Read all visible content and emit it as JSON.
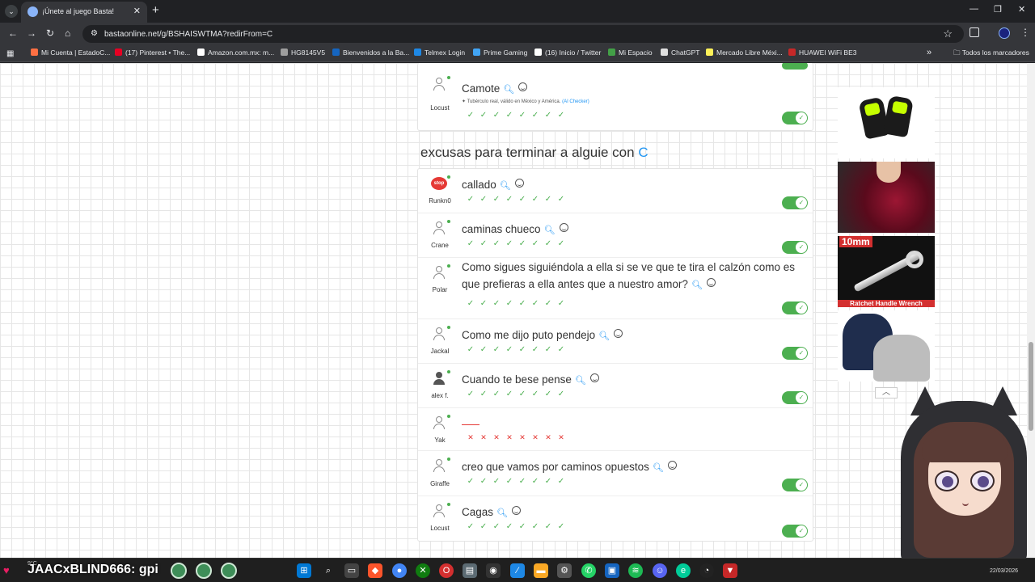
{
  "browser": {
    "tab_title": "¡Únete al juego Basta!",
    "url": "bastaonline.net/g/BSHAISWTMA?redirFrom=C",
    "bookmarks": [
      {
        "label": "Mi Cuenta | EstadoC...",
        "color": "#ff7043"
      },
      {
        "label": "(17) Pinterest • The...",
        "color": "#e60023"
      },
      {
        "label": "Amazon.com.mx: m...",
        "color": "#ffffff"
      },
      {
        "label": "HG8145V5",
        "color": "#9e9e9e"
      },
      {
        "label": "Bienvenidos a la Ba...",
        "color": "#1565c0"
      },
      {
        "label": "Telmex Login",
        "color": "#1e88e5"
      },
      {
        "label": "Prime Gaming",
        "color": "#42a5f5"
      },
      {
        "label": "(16) Inicio / Twitter",
        "color": "#ffffff"
      },
      {
        "label": "Mi Espacio",
        "color": "#43a047"
      },
      {
        "label": "ChatGPT",
        "color": "#e0e0e0"
      },
      {
        "label": "Mercado Libre Méxi...",
        "color": "#fff159"
      },
      {
        "label": "HUAWEI WiFi BE3",
        "color": "#c62828"
      }
    ],
    "bookmarks_folder": "Todos los marcadores"
  },
  "game": {
    "previous_answer": {
      "player": "Locust",
      "text": "Camote",
      "note": "Tubérculo real, válido en México y América.",
      "note_link": "(AI Checker)",
      "votes": [
        "yes",
        "yes",
        "yes",
        "yes",
        "yes",
        "yes",
        "yes",
        "yes"
      ],
      "valid": true
    },
    "category_title": "excusas para terminar a alguie con",
    "letter": "C",
    "answers": [
      {
        "player": "Runkn0",
        "text": "callado",
        "avatar": "stop",
        "votes": [
          "yes",
          "yes",
          "yes",
          "yes",
          "yes",
          "yes",
          "yes",
          "yes"
        ],
        "valid": true
      },
      {
        "player": "Crane",
        "text": "caminas chueco",
        "avatar": "default",
        "votes": [
          "yes",
          "yes",
          "yes",
          "yes",
          "yes",
          "yes",
          "yes",
          "yes"
        ],
        "valid": true
      },
      {
        "player": "Polar",
        "text": "Como sigues siguiéndola a ella si se ve que te tira el calzón como es que prefieras a ella antes que a nuestro amor?",
        "avatar": "default",
        "votes": [
          "yes",
          "yes",
          "yes",
          "yes",
          "yes",
          "yes",
          "yes",
          "yes"
        ],
        "valid": true
      },
      {
        "player": "Jackal",
        "text": "Como me dijo puto pendejo",
        "avatar": "default",
        "votes": [
          "yes",
          "yes",
          "yes",
          "yes",
          "yes",
          "yes",
          "yes",
          "yes"
        ],
        "valid": true
      },
      {
        "player": "alex f.",
        "text": "Cuando te bese pense",
        "avatar": "dark",
        "votes": [
          "yes",
          "yes",
          "yes",
          "yes",
          "yes",
          "yes",
          "yes",
          "yes"
        ],
        "valid": true
      },
      {
        "player": "Yak",
        "text": "",
        "avatar": "default",
        "votes": [
          "no",
          "no",
          "no",
          "no",
          "no",
          "no",
          "no",
          "no"
        ],
        "valid": false
      },
      {
        "player": "Giraffe",
        "text": "creo que vamos por caminos opuestos",
        "avatar": "default",
        "votes": [
          "yes",
          "yes",
          "yes",
          "yes",
          "yes",
          "yes",
          "yes",
          "yes"
        ],
        "valid": true
      },
      {
        "player": "Locust",
        "text": "Cagas",
        "avatar": "default",
        "votes": [
          "yes",
          "yes",
          "yes",
          "yes",
          "yes",
          "yes",
          "yes",
          "yes"
        ],
        "valid": true
      }
    ]
  },
  "ads": {
    "wrench_top": "10mm",
    "wrench_bottom": "Ratchet Handle Wrench"
  },
  "overlay": {
    "weather": "9°C",
    "chat_user": "JAACxBLIND666",
    "chat_message": ": gpi"
  },
  "taskbar": {
    "date": "22/03/2026"
  },
  "icons": {
    "yes_vote": "check-icon",
    "no_vote": "cross-icon",
    "search": "search-icon",
    "emoji": "emoji-icon"
  }
}
